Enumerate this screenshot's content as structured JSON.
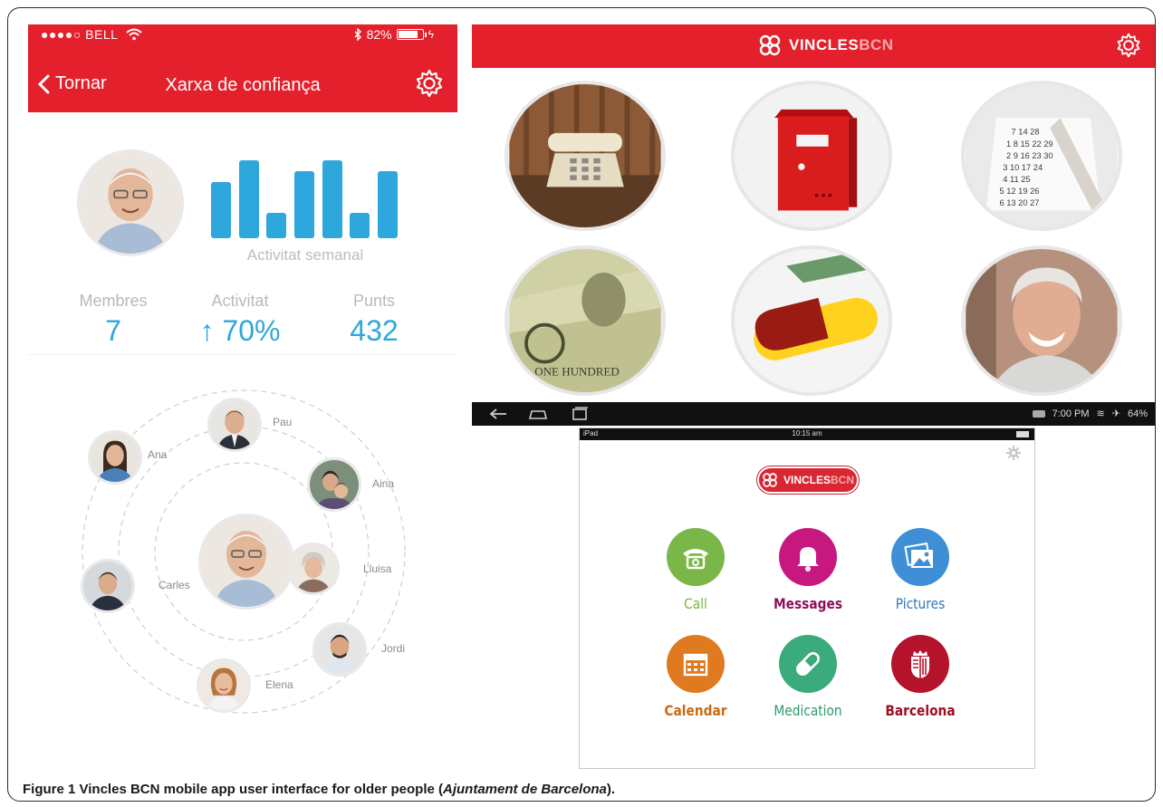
{
  "colors": {
    "brand_red": "#e3202b",
    "stat_blue": "#2ea7dc"
  },
  "phone": {
    "status": {
      "carrier": "●●●●○ BELL",
      "battery": "82%",
      "wifi_icon": "wifi-icon",
      "bluetooth_icon": "bluetooth-icon"
    },
    "nav": {
      "back_label": "Tornar",
      "title": "Xarxa de confiança",
      "settings_icon": "gear-icon"
    },
    "activity": {
      "caption": "Activitat semanal",
      "bars": [
        0.72,
        1.0,
        0.32,
        0.86,
        1.0,
        0.32,
        0.86
      ]
    },
    "stats": [
      {
        "label": "Membres",
        "value": "7"
      },
      {
        "label": "Activitat",
        "value": "↑ 70%"
      },
      {
        "label": "Punts",
        "value": "432"
      }
    ],
    "network": {
      "members": [
        "Pau",
        "Ana",
        "Aina",
        "Carles",
        "Lluisa",
        "Jordi",
        "Elena"
      ]
    }
  },
  "android": {
    "brand": {
      "vincles": "VINCLES",
      "bcn": "BCN"
    },
    "tiles": [
      "telephone",
      "mailbox",
      "calendar",
      "money",
      "medication",
      "contact-photo"
    ],
    "status": {
      "time": "7:00 PM",
      "battery": "64%"
    }
  },
  "ipad": {
    "status": {
      "carrier": "iPad",
      "time": "10:15 am"
    },
    "brand": {
      "vincles": "VINCLES",
      "bcn": "BCN"
    },
    "apps": [
      {
        "label": "Call",
        "color": "#7ab648",
        "label_color": "#7ab648",
        "icon": "phone-icon"
      },
      {
        "label": "Messages",
        "color": "#c6187e",
        "label_color": "#8e1057",
        "icon": "bell-icon"
      },
      {
        "label": "Pictures",
        "color": "#3f8fd6",
        "label_color": "#3678b8",
        "icon": "pictures-icon"
      },
      {
        "label": "Calendar",
        "color": "#e07a20",
        "label_color": "#c96a14",
        "icon": "calendar-icon"
      },
      {
        "label": "Medication",
        "color": "#3cab7c",
        "label_color": "#2d9a6b",
        "icon": "pill-icon"
      },
      {
        "label": "Barcelona",
        "color": "#b5122b",
        "label_color": "#9e0f24",
        "icon": "barcelona-shield-icon"
      }
    ]
  },
  "caption": {
    "prefix": "Figure 1",
    "text": " Vincles BCN mobile app user interface for older people (",
    "source": "Ajuntament de Barcelona",
    "suffix": ")."
  }
}
